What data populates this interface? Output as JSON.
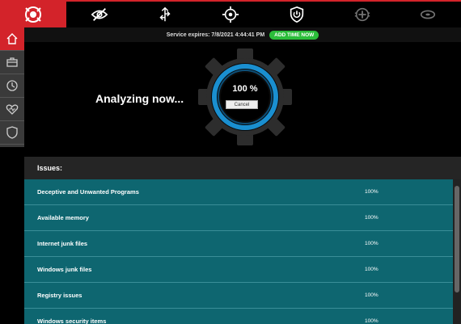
{
  "toolbar": {
    "icons": [
      "logo-icon",
      "privacy-eye-slash-icon",
      "startup-arrows-icon",
      "crosshair-target-icon",
      "power-shield-icon",
      "health-plus-icon",
      "disk-icon"
    ]
  },
  "sidebar": {
    "items": [
      "home-icon",
      "toolbox-icon",
      "clock-icon",
      "heart-icon",
      "shield-icon"
    ]
  },
  "status": {
    "expires": "Service expires:  7/8/2021 4:44:41 PM",
    "add_time": "ADD TIME NOW"
  },
  "scan": {
    "analyzing": "Analyzing now...",
    "percent": "100 %",
    "cancel": "Cancel"
  },
  "issues": {
    "header": "Issues:",
    "rows": [
      {
        "name": "Deceptive and Unwanted Programs",
        "value": "100%"
      },
      {
        "name": "Available memory",
        "value": "100%"
      },
      {
        "name": "Internet junk files",
        "value": "100%"
      },
      {
        "name": "Windows junk files",
        "value": "100%"
      },
      {
        "name": "Registry issues",
        "value": "100%"
      },
      {
        "name": "Windows security items",
        "value": "100%"
      }
    ]
  },
  "colors": {
    "accent": "#d3232a",
    "ring": "#1a8fd0",
    "issues_bg": "#0e6670",
    "add_time_bg": "#2bbd3a"
  }
}
